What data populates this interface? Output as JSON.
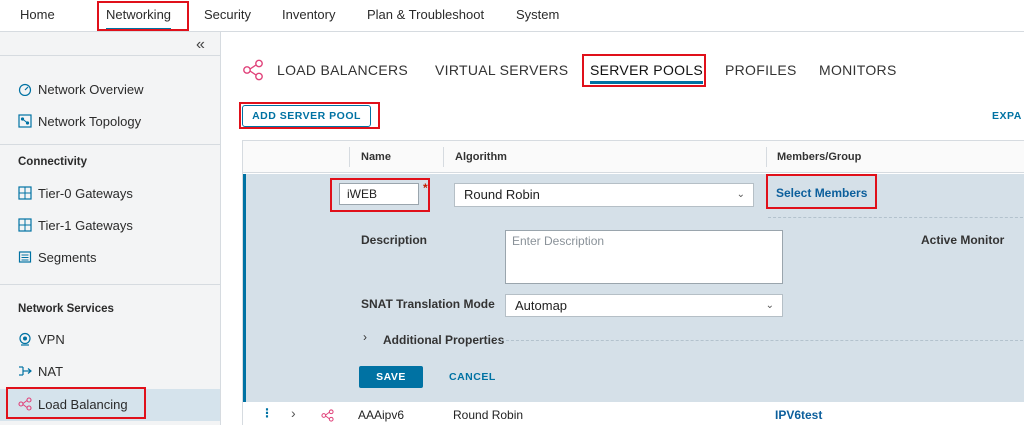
{
  "topnav": {
    "items": [
      "Home",
      "Networking",
      "Security",
      "Inventory",
      "Plan & Troubleshoot",
      "System"
    ]
  },
  "sidebar": {
    "collapse_glyph": "«",
    "items": {
      "network_overview": "Network Overview",
      "network_topology": "Network Topology",
      "tier0": "Tier-0 Gateways",
      "tier1": "Tier-1 Gateways",
      "segments": "Segments",
      "vpn": "VPN",
      "nat": "NAT",
      "load_balancing": "Load Balancing"
    },
    "sections": {
      "connectivity": "Connectivity",
      "network_services": "Network Services"
    }
  },
  "tabs": [
    "LOAD BALANCERS",
    "VIRTUAL SERVERS",
    "SERVER POOLS",
    "PROFILES",
    "MONITORS"
  ],
  "toolbar": {
    "add_server_pool": "ADD SERVER POOL",
    "expand": "EXPA"
  },
  "grid": {
    "headers": {
      "name": "Name",
      "algorithm": "Algorithm",
      "members": "Members/Group"
    },
    "edit": {
      "name_value": "iWEB",
      "required_mark": "*",
      "algorithm_value": "Round Robin",
      "select_members": "Select Members",
      "description_label": "Description",
      "description_placeholder": "Enter Description",
      "active_monitor_label": "Active Monitor",
      "snat_label": "SNAT Translation Mode",
      "snat_value": "Automap",
      "additional_properties": "Additional Properties",
      "save": "SAVE",
      "cancel": "CANCEL"
    },
    "rows": [
      {
        "name": "AAAipv6",
        "algorithm": "Round Robin",
        "members": "IPV6test"
      }
    ]
  },
  "colors": {
    "accent": "#0072a3",
    "highlight": "#e0101a",
    "panel": "#d5e0e8"
  }
}
